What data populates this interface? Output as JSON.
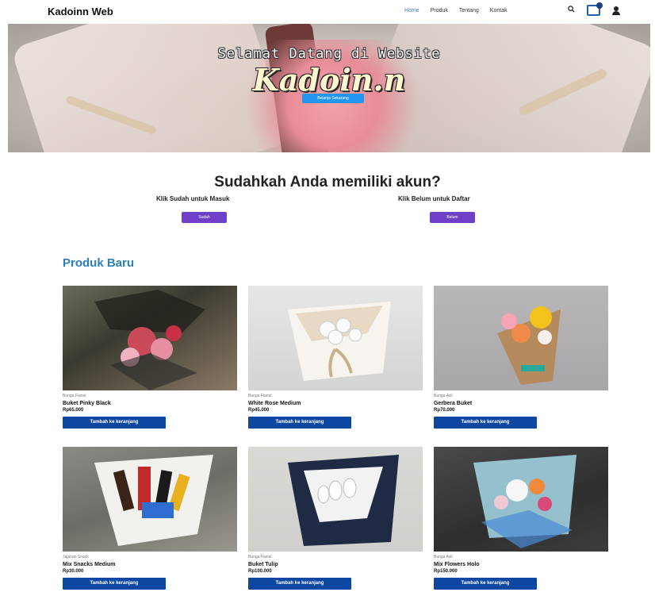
{
  "navbar": {
    "brand": "Kadoinn Web",
    "links": [
      "Home",
      "Produk",
      "Tentang",
      "Kontak"
    ],
    "active": "Home",
    "icons": [
      "search-icon",
      "cart-icon",
      "user-icon"
    ]
  },
  "hero": {
    "title": "Selamat Datang di Website",
    "brand": "Kadoin.n",
    "button": "Belanja Sekarang"
  },
  "account": {
    "title": "Sudahkah Anda memiliki akun?",
    "left_text": "Klik Sudah untuk Masuk",
    "right_text": "Klik Belum untuk Daftar",
    "left_button": "Sudah",
    "right_button": "Belum"
  },
  "products": {
    "title": "Produk Baru",
    "button_label": "Tambah ke keranjang",
    "items": [
      {
        "category": "Bunga Flanel",
        "name": "Buket Pinky Black",
        "price": "Rp65.000"
      },
      {
        "category": "Bunga Flanel",
        "name": "White Rose Medium",
        "price": "Rp45.000"
      },
      {
        "category": "Bunga Asli",
        "name": "Gerbera Buket",
        "price": "Rp70.000"
      },
      {
        "category": "Jajanan Snack",
        "name": "Mix Snacks Medium",
        "price": "Rp30.000"
      },
      {
        "category": "Bunga Flanel",
        "name": "Buket Tulip",
        "price": "Rp100.000"
      },
      {
        "category": "Bunga Asli",
        "name": "Mix Flowers Holo",
        "price": "Rp150.000"
      }
    ]
  },
  "colors": {
    "accent_blue": "#0d47a1",
    "hero_button": "#2196f3",
    "account_button": "#6f3fc7",
    "section_title": "#2d7fb8"
  }
}
